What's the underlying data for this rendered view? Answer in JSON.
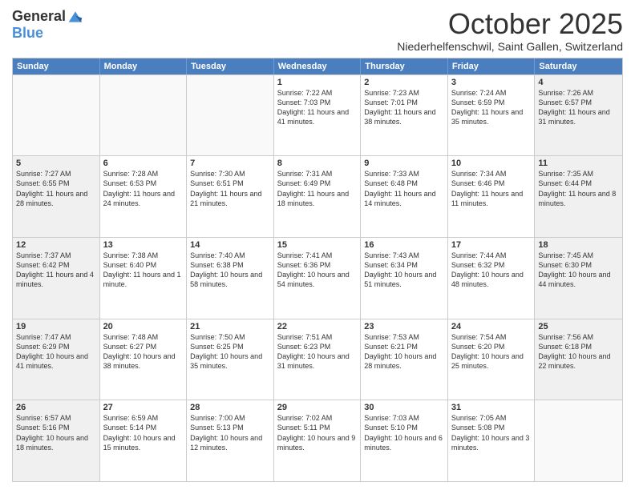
{
  "logo": {
    "general": "General",
    "blue": "Blue"
  },
  "title": "October 2025",
  "location": "Niederhelfenschwil, Saint Gallen, Switzerland",
  "headers": [
    "Sunday",
    "Monday",
    "Tuesday",
    "Wednesday",
    "Thursday",
    "Friday",
    "Saturday"
  ],
  "weeks": [
    [
      {
        "day": "",
        "info": "",
        "empty": true
      },
      {
        "day": "",
        "info": "",
        "empty": true
      },
      {
        "day": "",
        "info": "",
        "empty": true
      },
      {
        "day": "1",
        "info": "Sunrise: 7:22 AM\nSunset: 7:03 PM\nDaylight: 11 hours and 41 minutes."
      },
      {
        "day": "2",
        "info": "Sunrise: 7:23 AM\nSunset: 7:01 PM\nDaylight: 11 hours and 38 minutes."
      },
      {
        "day": "3",
        "info": "Sunrise: 7:24 AM\nSunset: 6:59 PM\nDaylight: 11 hours and 35 minutes."
      },
      {
        "day": "4",
        "info": "Sunrise: 7:26 AM\nSunset: 6:57 PM\nDaylight: 11 hours and 31 minutes.",
        "shaded": true
      }
    ],
    [
      {
        "day": "5",
        "info": "Sunrise: 7:27 AM\nSunset: 6:55 PM\nDaylight: 11 hours and 28 minutes.",
        "shaded": true
      },
      {
        "day": "6",
        "info": "Sunrise: 7:28 AM\nSunset: 6:53 PM\nDaylight: 11 hours and 24 minutes."
      },
      {
        "day": "7",
        "info": "Sunrise: 7:30 AM\nSunset: 6:51 PM\nDaylight: 11 hours and 21 minutes."
      },
      {
        "day": "8",
        "info": "Sunrise: 7:31 AM\nSunset: 6:49 PM\nDaylight: 11 hours and 18 minutes."
      },
      {
        "day": "9",
        "info": "Sunrise: 7:33 AM\nSunset: 6:48 PM\nDaylight: 11 hours and 14 minutes."
      },
      {
        "day": "10",
        "info": "Sunrise: 7:34 AM\nSunset: 6:46 PM\nDaylight: 11 hours and 11 minutes."
      },
      {
        "day": "11",
        "info": "Sunrise: 7:35 AM\nSunset: 6:44 PM\nDaylight: 11 hours and 8 minutes.",
        "shaded": true
      }
    ],
    [
      {
        "day": "12",
        "info": "Sunrise: 7:37 AM\nSunset: 6:42 PM\nDaylight: 11 hours and 4 minutes.",
        "shaded": true
      },
      {
        "day": "13",
        "info": "Sunrise: 7:38 AM\nSunset: 6:40 PM\nDaylight: 11 hours and 1 minute."
      },
      {
        "day": "14",
        "info": "Sunrise: 7:40 AM\nSunset: 6:38 PM\nDaylight: 10 hours and 58 minutes."
      },
      {
        "day": "15",
        "info": "Sunrise: 7:41 AM\nSunset: 6:36 PM\nDaylight: 10 hours and 54 minutes."
      },
      {
        "day": "16",
        "info": "Sunrise: 7:43 AM\nSunset: 6:34 PM\nDaylight: 10 hours and 51 minutes."
      },
      {
        "day": "17",
        "info": "Sunrise: 7:44 AM\nSunset: 6:32 PM\nDaylight: 10 hours and 48 minutes."
      },
      {
        "day": "18",
        "info": "Sunrise: 7:45 AM\nSunset: 6:30 PM\nDaylight: 10 hours and 44 minutes.",
        "shaded": true
      }
    ],
    [
      {
        "day": "19",
        "info": "Sunrise: 7:47 AM\nSunset: 6:29 PM\nDaylight: 10 hours and 41 minutes.",
        "shaded": true
      },
      {
        "day": "20",
        "info": "Sunrise: 7:48 AM\nSunset: 6:27 PM\nDaylight: 10 hours and 38 minutes."
      },
      {
        "day": "21",
        "info": "Sunrise: 7:50 AM\nSunset: 6:25 PM\nDaylight: 10 hours and 35 minutes."
      },
      {
        "day": "22",
        "info": "Sunrise: 7:51 AM\nSunset: 6:23 PM\nDaylight: 10 hours and 31 minutes."
      },
      {
        "day": "23",
        "info": "Sunrise: 7:53 AM\nSunset: 6:21 PM\nDaylight: 10 hours and 28 minutes."
      },
      {
        "day": "24",
        "info": "Sunrise: 7:54 AM\nSunset: 6:20 PM\nDaylight: 10 hours and 25 minutes."
      },
      {
        "day": "25",
        "info": "Sunrise: 7:56 AM\nSunset: 6:18 PM\nDaylight: 10 hours and 22 minutes.",
        "shaded": true
      }
    ],
    [
      {
        "day": "26",
        "info": "Sunrise: 6:57 AM\nSunset: 5:16 PM\nDaylight: 10 hours and 18 minutes.",
        "shaded": true
      },
      {
        "day": "27",
        "info": "Sunrise: 6:59 AM\nSunset: 5:14 PM\nDaylight: 10 hours and 15 minutes."
      },
      {
        "day": "28",
        "info": "Sunrise: 7:00 AM\nSunset: 5:13 PM\nDaylight: 10 hours and 12 minutes."
      },
      {
        "day": "29",
        "info": "Sunrise: 7:02 AM\nSunset: 5:11 PM\nDaylight: 10 hours and 9 minutes."
      },
      {
        "day": "30",
        "info": "Sunrise: 7:03 AM\nSunset: 5:10 PM\nDaylight: 10 hours and 6 minutes."
      },
      {
        "day": "31",
        "info": "Sunrise: 7:05 AM\nSunset: 5:08 PM\nDaylight: 10 hours and 3 minutes."
      },
      {
        "day": "",
        "info": "",
        "empty": true
      }
    ]
  ]
}
